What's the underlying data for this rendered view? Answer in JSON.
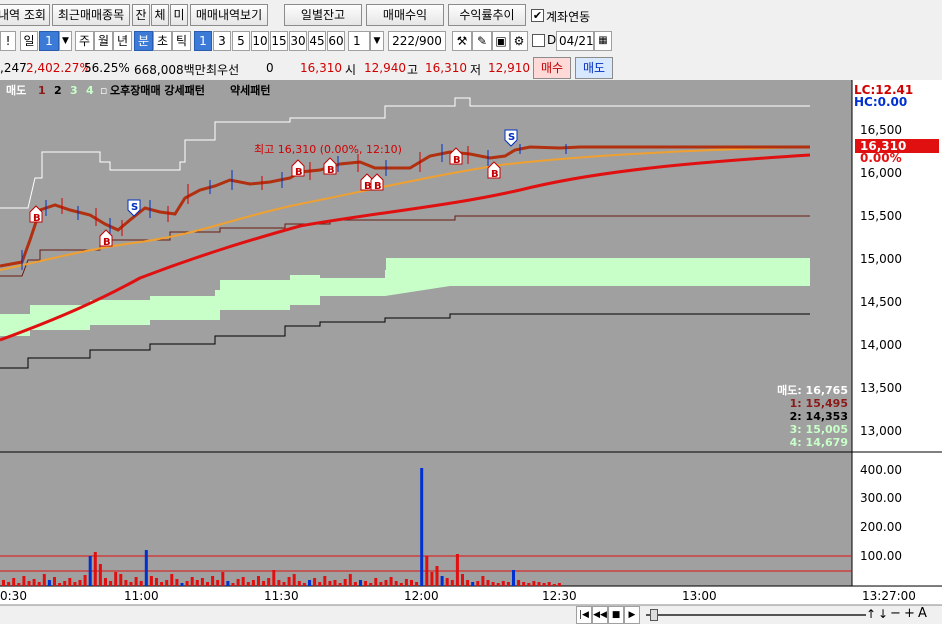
{
  "toolbar1": {
    "btn_partial": "내역 조회",
    "btn_recent": "최근매매종목",
    "btn_jan": "잔",
    "btn_che": "체",
    "btn_mi": "미",
    "btn_history": "매매내역보기",
    "btn_daily": "일별잔고",
    "btn_profit": "매매수익",
    "btn_rate": "수익률추이",
    "chk_account_label": "계좌연동",
    "chk_account_checked": "✔"
  },
  "toolbar2": {
    "excl": "!",
    "day_unit": "일",
    "day_value": "1",
    "periods": [
      "주",
      "월",
      "년",
      "분",
      "초",
      "틱"
    ],
    "intervals": [
      "1",
      "3",
      "5",
      "10",
      "15",
      "30",
      "45",
      "60"
    ],
    "count_value": "1",
    "page_counter": "222/900",
    "d_label": "D",
    "date_value": "04/21"
  },
  "ticker": {
    "volume_partial": ",247",
    "rate": "2,402.27%",
    "pct": "56.25%",
    "amount": "668,008백만",
    "best_bid_label": "최우선",
    "best_bid_value": "0",
    "price": "16,310",
    "open_label": "시",
    "open_value": "12,940",
    "high_label": "고",
    "high_value": "16,310",
    "low_label": "저",
    "low_value": "12,910",
    "buy_btn": "매수",
    "sell_btn": "매도"
  },
  "legend": {
    "sell": "매도",
    "n1": "1",
    "n2": "2",
    "n3": "3",
    "n4": "4",
    "dot": "▫",
    "pattern": "오후장매매 강세패턴",
    "weak": "약세패턴"
  },
  "right_panel": {
    "lc": "LC:12.41",
    "hc": "HC:0.00",
    "current_price": "16,310",
    "current_pct": "0.00%",
    "price_ticks": [
      "16,500",
      "16,000",
      "15,500",
      "15,000",
      "14,500",
      "14,000",
      "13,500",
      "13,000"
    ],
    "volume_ticks": [
      "400.00",
      "300.00",
      "200.00",
      "100.00"
    ],
    "time_axis_right": "13:27:00"
  },
  "annotations": {
    "high_label": "최고 16,310 (0.00%, 12:10)",
    "values": [
      {
        "label": "매도: 16,765",
        "color": "#ffffff"
      },
      {
        "label": "1: 15,495",
        "color": "#8b1a1a"
      },
      {
        "label": "2: 14,353",
        "color": "#000000"
      },
      {
        "label": "3: 15,005",
        "color": "#c8ffc8"
      },
      {
        "label": "4: 14,679",
        "color": "#c8ffc8"
      }
    ]
  },
  "time_axis": [
    "0:30",
    "11:00",
    "11:30",
    "12:00",
    "12:30",
    "13:00"
  ],
  "colors": {
    "chart_bg": "#a0a0a0",
    "ma_red": "#e01010",
    "ma_orange": "#f0a030",
    "cloud": "#c8ffc8",
    "price_line": "#b03010"
  }
}
